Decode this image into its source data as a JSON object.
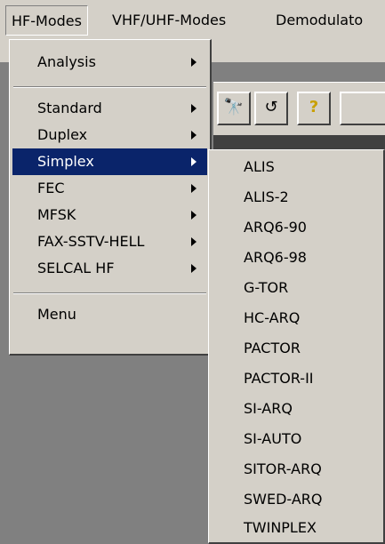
{
  "menubar": {
    "items": [
      {
        "label": "HF-Modes"
      },
      {
        "label": "VHF/UHF-Modes"
      },
      {
        "label": "Demodulato"
      }
    ]
  },
  "hf_menu": {
    "items": [
      {
        "label": "Analysis",
        "has_submenu": true
      },
      {
        "label": "Standard",
        "has_submenu": true
      },
      {
        "label": "Duplex",
        "has_submenu": true
      },
      {
        "label": "Simplex",
        "has_submenu": true,
        "selected": true
      },
      {
        "label": "FEC",
        "has_submenu": true
      },
      {
        "label": "MFSK",
        "has_submenu": true
      },
      {
        "label": "FAX-SSTV-HELL",
        "has_submenu": true
      },
      {
        "label": "SELCAL HF",
        "has_submenu": true
      },
      {
        "label": "Menu",
        "has_submenu": false
      }
    ]
  },
  "simplex_submenu": {
    "items": [
      {
        "label": "ALIS"
      },
      {
        "label": "ALIS-2"
      },
      {
        "label": "ARQ6-90"
      },
      {
        "label": "ARQ6-98"
      },
      {
        "label": "G-TOR"
      },
      {
        "label": "HC-ARQ"
      },
      {
        "label": "PACTOR"
      },
      {
        "label": "PACTOR-II"
      },
      {
        "label": "SI-ARQ"
      },
      {
        "label": "SI-AUTO"
      },
      {
        "label": "SITOR-ARQ"
      },
      {
        "label": "SWED-ARQ"
      },
      {
        "label": "TWINPLEX"
      }
    ]
  },
  "toolbar": {
    "buttons": [
      {
        "icon": "binoculars-icon"
      },
      {
        "icon": "find-replace-icon"
      },
      {
        "icon": "help-icon"
      }
    ]
  },
  "colors": {
    "face": "#d4d0c8",
    "selection": "#0a246a",
    "workspace": "#808080"
  }
}
